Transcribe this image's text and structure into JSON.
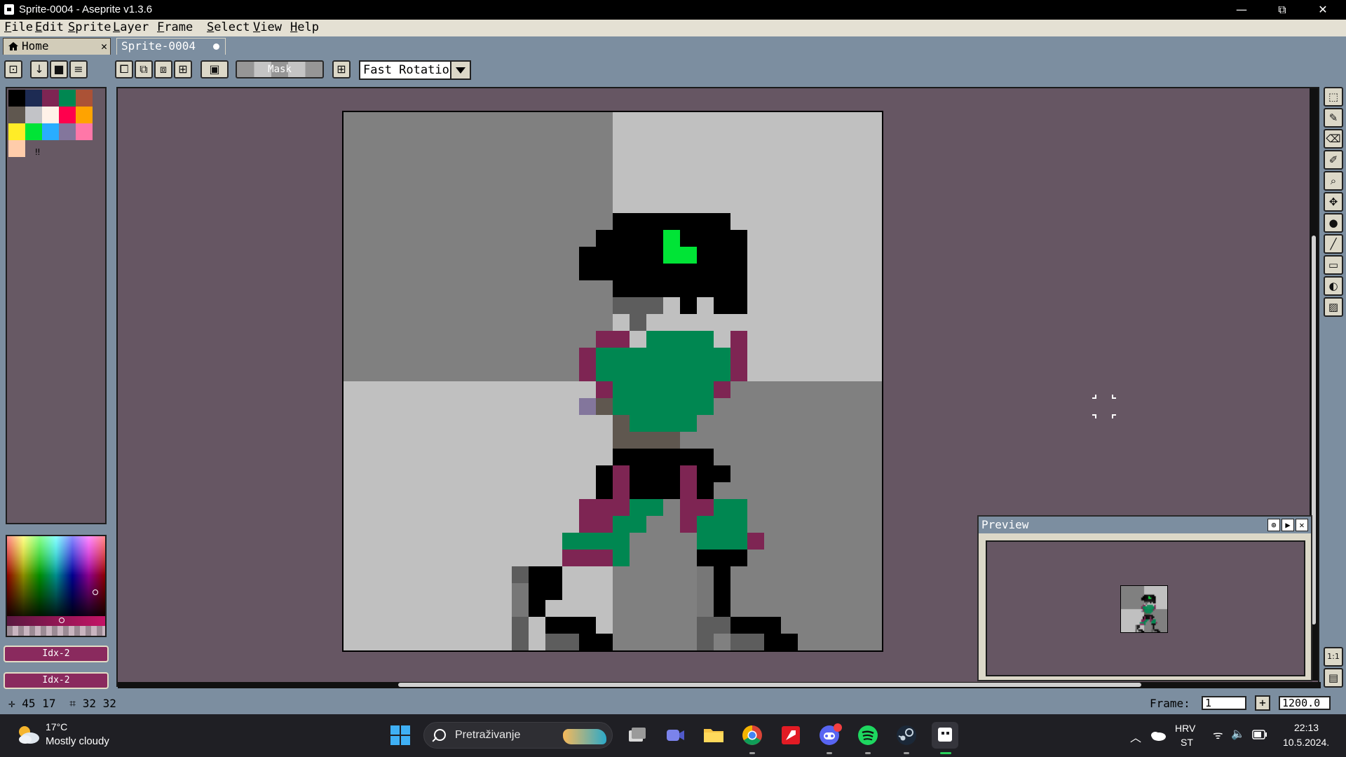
{
  "window": {
    "title": "Sprite-0004 - Aseprite v1.3.6",
    "minimize": "—",
    "restore": "⧉",
    "close": "✕"
  },
  "menu": [
    "File",
    "Edit",
    "Sprite",
    "Layer",
    "Frame",
    "Select",
    "View",
    "Help"
  ],
  "tabs": [
    {
      "label": "Home",
      "close": "✕"
    },
    {
      "label": "Sprite-0004"
    }
  ],
  "toolbar": {
    "mask_label": "Mask",
    "rotation_algorithm": "Fast Rotation"
  },
  "palette": {
    "colors": [
      "#000000",
      "#1d2b53",
      "#7e2553",
      "#008751",
      "#ab5236",
      "#5f574f",
      "#c2c3c7",
      "#fff1e8",
      "#ff004d",
      "#ffa300",
      "#ffec27",
      "#00e436",
      "#29adff",
      "#83769c",
      "#ff77a8",
      "#ffccaa"
    ],
    "more_glyph": "‼"
  },
  "color_bar": {
    "foreground": "Idx-2",
    "background": "Idx-2"
  },
  "sprite": {
    "checker_colors": {
      "dark": "#808080",
      "light": "#c0c0c0"
    },
    "palette_key": {
      "K": "#000000",
      "G": "#00e436",
      "T": "#008751",
      "P": "#7e2553",
      "D": "#5f574f",
      "M": "#777777",
      "L": "#5d5d5d",
      "V": "#83769c"
    },
    "rows": [
      "................................",
      "................................",
      "................................",
      "................................",
      "................................",
      "................................",
      "................KKKKKKK.........",
      "...............KKKKGKKKK........",
      "..............KKKKKGGKKK........",
      "..............KKKKKKKKKK........",
      "................KKKKKKKK........",
      "................LLL.K.KK........",
      ".................L..............",
      "...............PP.TTTT.P........",
      "..............PTTTTTTTTP........",
      "..............PTTTTTTTTP........",
      "...............PTTTTTTP.........",
      "..............VDTTTTTT..........",
      "................DTTTT...........",
      "................DDDD............",
      "................KKKKKK..........",
      "...............KPKKKPKK.........",
      "...............KPKKKPK..........",
      "..............PPPTT.PPTT........",
      "..............PPTT..PTTT........",
      ".............TTTT....TTTP........",
      ".............PPPT....KKK........",
      "..........LKK........MK.........",
      "..........MKK........MK.........",
      "..........MK.........MK.........",
      "..........L.KKK......LLKKK......",
      "..........L.LLKK.....L.LLKK....."
    ]
  },
  "preview": {
    "title": "Preview"
  },
  "tools": [
    "⬚",
    "✎",
    "⌫",
    "✐",
    "⌕",
    "✥",
    "●",
    "╱",
    "▭",
    "◐",
    "▨"
  ],
  "status": {
    "cursor_glyph": "✛",
    "cursor_pos": "45 17",
    "size_glyph": "⌗",
    "size": "32 32",
    "frame_label": "Frame:",
    "frame_value": "1",
    "zoom": "1200.0"
  },
  "taskbar": {
    "weather_temp": "17°C",
    "weather_desc": "Mostly cloudy",
    "search_placeholder": "Pretraživanje",
    "lang_top": "HRV",
    "lang_bottom": "ST",
    "time": "22:13",
    "date": "10.5.2024."
  }
}
